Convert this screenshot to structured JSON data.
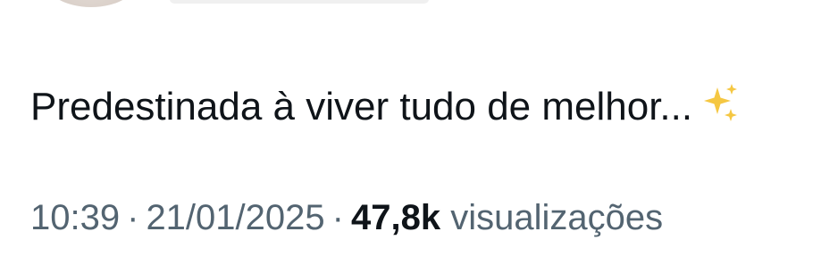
{
  "tweet": {
    "text": "Predestinada à viver tudo de melhor...",
    "emoji_icon": "sparkles-icon"
  },
  "meta": {
    "time": "10:39",
    "separator": "·",
    "date": "21/01/2025",
    "views_count": "47,8k",
    "views_label": "visualizações"
  },
  "colors": {
    "text_primary": "#0f1419",
    "text_secondary": "#536471",
    "sparkle": "#f5c742"
  }
}
